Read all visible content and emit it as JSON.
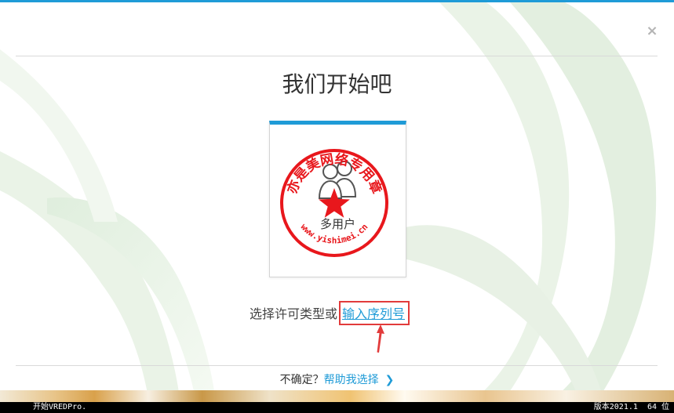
{
  "dialog": {
    "title": "我们开始吧",
    "close_glyph": "×"
  },
  "license_option": {
    "label": "多用户",
    "icon": "multi-user-icon"
  },
  "selection": {
    "prompt": "选择许可类型或",
    "serial_link": "输入序列号"
  },
  "help": {
    "question": "不确定？",
    "link": "帮助我选择",
    "chevron_glyph": "❯"
  },
  "watermark": {
    "text": "亦是美网络专用章",
    "url": "www.yishimei.cn"
  },
  "status_bar": {
    "left": "开始VREDPro.",
    "version": "版本2021.1",
    "bits": "64 位"
  },
  "colors": {
    "accent": "#1f9bd7",
    "annotation": "#e23b3b",
    "seal": "#e8171c"
  }
}
